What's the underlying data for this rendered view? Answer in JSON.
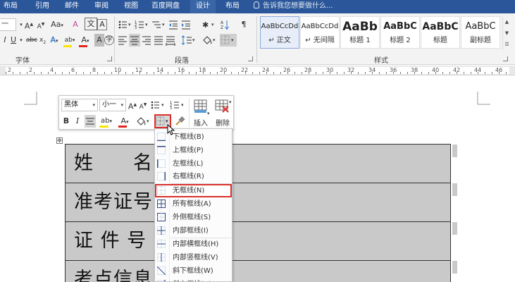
{
  "ribbon_tabs": [
    {
      "label": "布局"
    },
    {
      "label": "引用"
    },
    {
      "label": "邮件"
    },
    {
      "label": "审阅"
    },
    {
      "label": "视图"
    },
    {
      "label": "百度网盘"
    },
    {
      "label": "设计"
    },
    {
      "label": "布局"
    }
  ],
  "tell_me": "告诉我您想要做什么...",
  "font_group": {
    "label": "字体",
    "font_size_fragment": "一",
    "grow_font": "A",
    "shrink_font": "A",
    "change_case": "Aa",
    "clear_formatting": "A",
    "text_effects": "A",
    "highlight": "ab",
    "font_color": "A",
    "char_shading": "A",
    "char_border": "A"
  },
  "paragraph_group": {
    "label": "段落"
  },
  "styles_group": {
    "label": "样式",
    "styles": [
      {
        "preview": "AaBbCcDd",
        "name": "正文",
        "selected": true
      },
      {
        "preview": "AaBbCcDd",
        "name": "无间隔",
        "selected": false
      },
      {
        "preview": "AaBb",
        "name": "标题 1",
        "selected": false
      },
      {
        "preview": "AaBbC",
        "name": "标题 2",
        "selected": false
      },
      {
        "preview": "AaBbC",
        "name": "标题",
        "selected": false
      },
      {
        "preview": "AaBbC",
        "name": "副标题",
        "selected": false
      }
    ]
  },
  "ruler": {
    "numbers": [
      "2",
      "2",
      "4",
      "6",
      "8",
      "10",
      "12",
      "14",
      "16",
      "18",
      "20",
      "22",
      "24",
      "26",
      "28",
      "30",
      "32",
      "34",
      "36",
      "38",
      "40",
      "42",
      "44",
      "46"
    ]
  },
  "mini_toolbar": {
    "font_name": "黑体",
    "font_size": "小一",
    "grow": "A",
    "shrink": "A",
    "bold": "B",
    "italic": "I",
    "highlight": "ab",
    "font_color": "A",
    "insert_label": "插入",
    "delete_label": "删除"
  },
  "borders_menu": [
    {
      "label": "下框线(B)",
      "icon": "bottom-border-icon"
    },
    {
      "label": "上框线(P)",
      "icon": "top-border-icon"
    },
    {
      "label": "左框线(L)",
      "icon": "left-border-icon"
    },
    {
      "label": "右框线(R)",
      "icon": "right-border-icon"
    },
    {
      "label": "无框线(N)",
      "icon": "no-border-icon",
      "highlighted": true
    },
    {
      "label": "所有框线(A)",
      "icon": "all-borders-icon"
    },
    {
      "label": "外侧框线(S)",
      "icon": "outside-borders-icon"
    },
    {
      "label": "内部框线(I)",
      "icon": "inside-borders-icon"
    },
    {
      "label": "内部横框线(H)",
      "icon": "inside-horizontal-border-icon"
    },
    {
      "label": "内部竖框线(V)",
      "icon": "inside-vertical-border-icon"
    },
    {
      "label": "斜下框线(W)",
      "icon": "diagonal-down-border-icon"
    },
    {
      "label": "斜上框线(U)",
      "icon": "diagonal-up-border-icon"
    }
  ],
  "table_rows": [
    {
      "label": "姓　　名"
    },
    {
      "label": "准考证号"
    },
    {
      "label": "证 件 号"
    },
    {
      "label": "考点信息"
    }
  ],
  "colors": {
    "ribbon_blue": "#2b579a",
    "highlight_red": "#d9302c",
    "cell_gray": "#c9c9c9",
    "font_color_red": "#e0261c",
    "highlight_yellow": "#ffe400"
  }
}
